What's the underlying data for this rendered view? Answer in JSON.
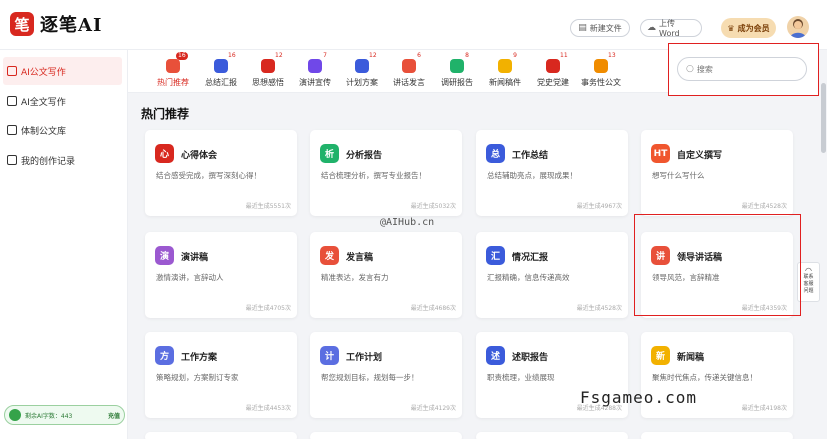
{
  "app": {
    "logo_char": "笔",
    "name": "逐笔AI"
  },
  "header": {
    "new_doc": "新建文件",
    "upload_word": "上传Word",
    "vip": "成为会员"
  },
  "sidebar": {
    "items": [
      {
        "label": "AI公文写作",
        "active": true
      },
      {
        "label": "AI全文写作",
        "active": false
      },
      {
        "label": "体制公文库",
        "active": false
      },
      {
        "label": "我的创作记录",
        "active": false
      }
    ],
    "quota_label": "剩余AI字数：443",
    "quota_link": "充值"
  },
  "categories": [
    {
      "label": "热门推荐",
      "badge": "16",
      "hot": true,
      "color": "#e8503a"
    },
    {
      "label": "总结汇报",
      "badge": "16",
      "color": "#3b5bdb"
    },
    {
      "label": "思想感悟",
      "badge": "12",
      "color": "#d8281f"
    },
    {
      "label": "演讲宣传",
      "badge": "7",
      "color": "#7048e8"
    },
    {
      "label": "计划方案",
      "badge": "12",
      "color": "#3b5bdb"
    },
    {
      "label": "讲话发言",
      "badge": "6",
      "color": "#e8503a"
    },
    {
      "label": "调研报告",
      "badge": "8",
      "color": "#20b26a"
    },
    {
      "label": "新闻稿件",
      "badge": "9",
      "color": "#f2b100"
    },
    {
      "label": "党史党建",
      "badge": "11",
      "color": "#d8281f"
    },
    {
      "label": "事务性公文",
      "badge": "13",
      "color": "#f08c00"
    }
  ],
  "search": {
    "placeholder": "搜索"
  },
  "section_title": "热门推荐",
  "cards": [
    {
      "title": "心得体会",
      "desc": "结合感受完成，撰写深刻心得！",
      "stat": "最近生成5551次",
      "color": "#d8281f",
      "glyph": "心"
    },
    {
      "title": "分析报告",
      "desc": "结合梳理分析，撰写专业报告！",
      "stat": "最近生成5032次",
      "color": "#20b26a",
      "glyph": "析"
    },
    {
      "title": "工作总结",
      "desc": "总结辅助亮点，展现成果！",
      "stat": "最近生成4967次",
      "color": "#3b5bdb",
      "glyph": "总"
    },
    {
      "title": "自定义撰写",
      "desc": "想写什么写什么",
      "stat": "最近生成4528次",
      "color": "#f0562e",
      "glyph": "HT"
    },
    {
      "title": "演讲稿",
      "desc": "激情演讲，言辞动人",
      "stat": "最近生成4705次",
      "color": "#9b59d0",
      "glyph": "演"
    },
    {
      "title": "发言稿",
      "desc": "精准表达，发言有力",
      "stat": "最近生成4686次",
      "color": "#e8503a",
      "glyph": "发"
    },
    {
      "title": "情况汇报",
      "desc": "汇报精确，信息传递高效",
      "stat": "最近生成4528次",
      "color": "#3b5bdb",
      "glyph": "汇"
    },
    {
      "title": "领导讲话稿",
      "desc": "领导风范，言辞精准",
      "stat": "最近生成4359次",
      "color": "#e8503a",
      "glyph": "讲"
    },
    {
      "title": "工作方案",
      "desc": "策略规划，方案制订专家",
      "stat": "最近生成4453次",
      "color": "#5b6ee1",
      "glyph": "方"
    },
    {
      "title": "工作计划",
      "desc": "帮您规划目标，规划每一步！",
      "stat": "最近生成4129次",
      "color": "#5b6ee1",
      "glyph": "计"
    },
    {
      "title": "述职报告",
      "desc": "职责梳理，业绩展现",
      "stat": "最近生成4288次",
      "color": "#3b5bdb",
      "glyph": "述"
    },
    {
      "title": "新闻稿",
      "desc": "聚焦时代焦点，传递关键信息！",
      "stat": "最近生成4198次",
      "color": "#f2b100",
      "glyph": "新"
    }
  ],
  "side_tool": {
    "line1": "联系",
    "line2": "客服",
    "line3": "问题"
  },
  "watermarks": {
    "aihub": "@AIHub.cn",
    "fsgameo": "Fsgameo.com"
  }
}
